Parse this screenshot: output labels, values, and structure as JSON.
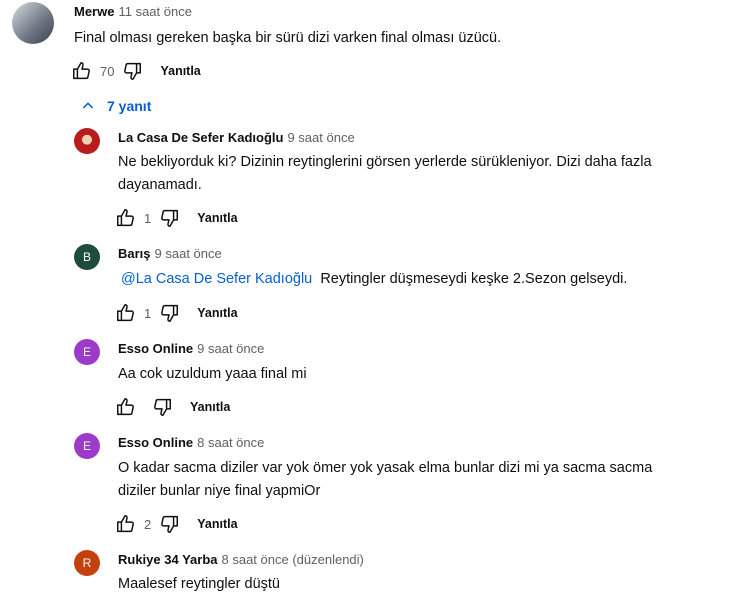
{
  "top_comment": {
    "author": "Merwe",
    "time": "11 saat önce",
    "text": "Final olması gereken başka bir sürü dizi varken final olması üzücü.",
    "likes": "70",
    "reply_label": "Yanıtla"
  },
  "replies_toggle": {
    "label": "7 yanıt"
  },
  "replies": [
    {
      "author": "La Casa De Sefer Kadıoğlu",
      "time": "9 saat önce",
      "avatar_color": "#8b1e1e",
      "avatar_letter": "",
      "text_line1": "Ne bekliyorduk ki? Dizinin reytinglerini görsen yerlerde sürükleniyor. Dizi daha fazla",
      "text_line2": "dayanamadı.",
      "likes": "1",
      "reply_label": "Yanıtla"
    },
    {
      "author": "Barış",
      "time": "9 saat önce",
      "avatar_color": "#1e4d3c",
      "avatar_letter": "B",
      "mention": "@La Casa De Sefer Kadıoğlu",
      "text": "Reytingler düşmeseydi keşke 2.Sezon gelseydi.",
      "likes": "1",
      "reply_label": "Yanıtla"
    },
    {
      "author": "Esso Online",
      "time": "9 saat önce",
      "avatar_color": "#9c3ac9",
      "avatar_letter": "E",
      "text": "Aa cok uzuldum yaaa final mi",
      "reply_label": "Yanıtla"
    },
    {
      "author": "Esso Online",
      "time": "8 saat önce",
      "avatar_color": "#9c3ac9",
      "avatar_letter": "E",
      "text_line1": "O kadar sacma diziler var yok ömer yok yasak elma bunlar dizi mi ya sacma sacma",
      "text_line2": "diziler bunlar niye final yapmiOr",
      "likes": "2",
      "reply_label": "Yanıtla"
    },
    {
      "author": "Rukiye 34 Yarba",
      "time": "8 saat önce (düzenlendi)",
      "avatar_color": "#c2410c",
      "avatar_letter": "R",
      "text": "Maalesef reytingler düştü"
    }
  ]
}
